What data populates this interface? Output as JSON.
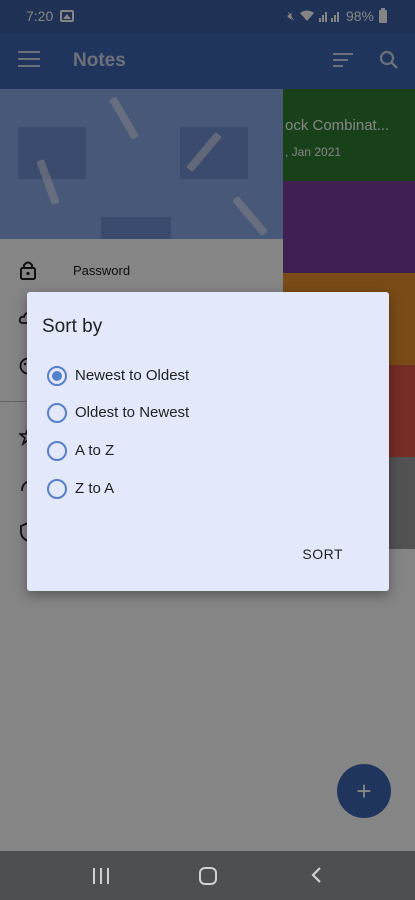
{
  "status_bar": {
    "time": "7:20",
    "battery": "98%"
  },
  "app_bar": {
    "title": "Notes"
  },
  "notes": [
    {
      "title": "ock Combinat...",
      "date": ", Jan 2021",
      "color": "#2e7d32"
    },
    {
      "title": "",
      "date": "",
      "color": "#7b3fa0"
    },
    {
      "title": "",
      "date": "",
      "color": "#e8912c"
    },
    {
      "title": "",
      "date": "",
      "color": "#e0564a"
    },
    {
      "title": "",
      "date": "",
      "color": "#9e9e9e"
    }
  ],
  "drawer": {
    "items": [
      {
        "label": "Password",
        "icon": "lock-icon"
      }
    ]
  },
  "dialog": {
    "title": "Sort by",
    "options": [
      {
        "label": "Newest to Oldest",
        "checked": true
      },
      {
        "label": "Oldest to Newest",
        "checked": false
      },
      {
        "label": "A to Z",
        "checked": false
      },
      {
        "label": "Z to A",
        "checked": false
      }
    ],
    "action": "SORT"
  },
  "fab": {
    "icon": "plus-icon",
    "symbol": "+"
  },
  "colors": {
    "primary": "#3f66b2",
    "status_bar": "#3d5ea4",
    "dialog_bg": "#e4e8fb",
    "radio_accent": "#5680cc"
  }
}
